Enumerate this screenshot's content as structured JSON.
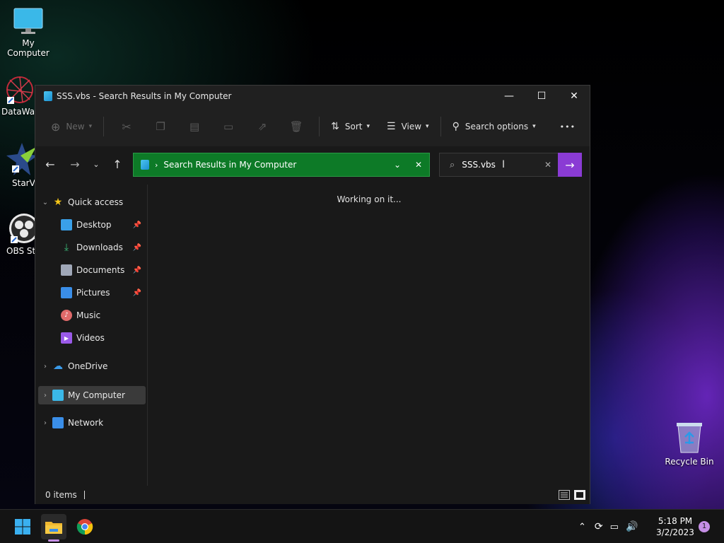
{
  "desktop": {
    "icons": [
      {
        "label": "My Computer"
      },
      {
        "label": "DataWag"
      },
      {
        "label": "StarVP"
      },
      {
        "label": "OBS Stu"
      },
      {
        "label": "Recycle Bin"
      }
    ]
  },
  "window": {
    "title": "SSS.vbs - Search Results in My Computer",
    "controls": {
      "minimize": "—",
      "maximize": "☐",
      "close": "✕"
    }
  },
  "toolbar": {
    "new_label": "New",
    "sort_label": "Sort",
    "view_label": "View",
    "search_options_label": "Search options",
    "more_label": "•••"
  },
  "navigation": {
    "address": "Search Results in My Computer",
    "search_value": "SSS.vbs"
  },
  "sidebar": {
    "quick_access": "Quick access",
    "items": [
      {
        "label": "Desktop",
        "icon": "desktop-folder-icon",
        "pinned": true,
        "color": "#3aa0e8"
      },
      {
        "label": "Downloads",
        "icon": "downloads-icon",
        "pinned": true,
        "color": "#3bbd7a"
      },
      {
        "label": "Documents",
        "icon": "documents-icon",
        "pinned": true,
        "color": "#a0a8b8"
      },
      {
        "label": "Pictures",
        "icon": "pictures-icon",
        "pinned": true,
        "color": "#3a8ee8"
      },
      {
        "label": "Music",
        "icon": "music-icon",
        "pinned": false,
        "color": "#e06a6a"
      },
      {
        "label": "Videos",
        "icon": "videos-icon",
        "pinned": false,
        "color": "#9a5ae8"
      }
    ],
    "onedrive": "OneDrive",
    "my_computer": "My Computer",
    "network": "Network"
  },
  "content": {
    "status_message": "Working on it..."
  },
  "statusbar": {
    "item_count": "0 items"
  },
  "taskbar": {
    "time": "5:18 PM",
    "date": "3/2/2023",
    "notification_count": "1"
  },
  "colors": {
    "address_bg": "#0d7a27",
    "search_go_bg": "#8a3bd4",
    "selected_bg": "#3a3a3a"
  }
}
